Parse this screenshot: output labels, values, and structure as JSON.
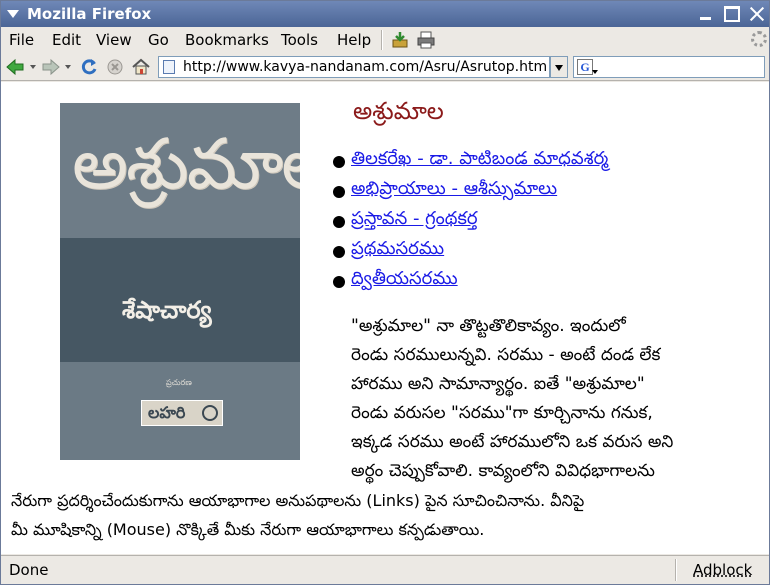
{
  "window": {
    "title": "Mozilla Firefox"
  },
  "menu": [
    "File",
    "Edit",
    "View",
    "Go",
    "Bookmarks",
    "Tools",
    "Help"
  ],
  "url": "http://www.kavya-nandanam.com/Asru/Asrutop.htm",
  "search": {
    "value": ""
  },
  "cover": {
    "title": "అశ్రుమాల",
    "author": "శేషాచార్య",
    "publisher_small": "ప్రచురణ",
    "publisher": "లహరి"
  },
  "page": {
    "heading": "అశ్రుమాల",
    "links": [
      "తిలకరేఖ - డా. పాటిబండ మాధవశర్మ",
      "అభిప్రాయాలు - ఆశీస్సుమాలు",
      "ప్రస్తావన - గ్రంథకర్త",
      "ప్రథమసరము",
      "ద్వితీయసరము"
    ],
    "intro_lines": [
      "\"అశ్రుమాల\" నా తొట్టతొలికావ్యం. ఇందులో",
      "రెండు సరములున్నవి. సరము - అంటే దండ లేక",
      "హారము అని సామాన్యార్థం. ఐతే \"అశ్రుమాల\"",
      "రెండు వరుసల \"సరము\"గా కూర్చినాను గనుక,",
      "ఇక్కడ సరము అంటే హారములోని ఒక వరుస అని",
      "అర్థం చెప్పుకోవాలి. కావ్యంలోని వివిధభాగాలను"
    ],
    "wide_lines": [
      "నేరుగా ప్రదర్శించేందుకుగాను ఆయాభాగాల అనుపథాలను (Links) పైన సూచించినాను. వీనిపై",
      "మీ మూషికాన్ని (Mouse) నొక్కితే మీకు నేరుగా ఆయాభాగాలు కన్పడుతాయి."
    ]
  },
  "status": {
    "text": "Done",
    "adblock": "Adblock"
  }
}
